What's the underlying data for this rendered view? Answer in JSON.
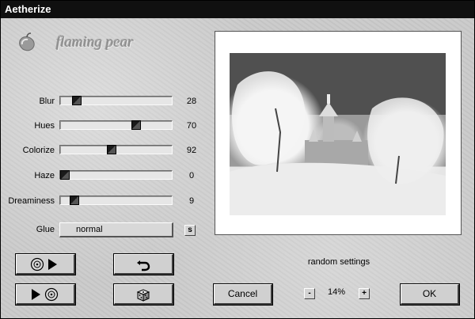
{
  "window": {
    "title": "Aetherize"
  },
  "logo": {
    "text": "flaming pear",
    "icon": "pear-icon"
  },
  "sliders": [
    {
      "label": "Blur",
      "value": "28",
      "fraction": 0.12
    },
    {
      "label": "Hues",
      "value": "70",
      "fraction": 0.7
    },
    {
      "label": "Colorize",
      "value": "92",
      "fraction": 0.46
    },
    {
      "label": "Haze",
      "value": "0",
      "fraction": 0.0
    },
    {
      "label": "Dreaminess",
      "value": "9",
      "fraction": 0.09
    }
  ],
  "glue": {
    "label": "Glue",
    "value": "normal",
    "side_button": "s"
  },
  "buttons": {
    "load_icon": "disc-play-icon",
    "save_icon": "play-disc-icon",
    "undo_icon": "undo-arrow-icon",
    "random_icon": "dice-icon",
    "cancel": "Cancel",
    "ok": "OK"
  },
  "preview": {
    "caption": "random settings"
  },
  "zoom": {
    "minus": "-",
    "value": "14%",
    "plus": "+"
  },
  "colors": {
    "titlebar": "#101010",
    "panel": "#cacaca",
    "thumb": "#1a1a1a"
  }
}
